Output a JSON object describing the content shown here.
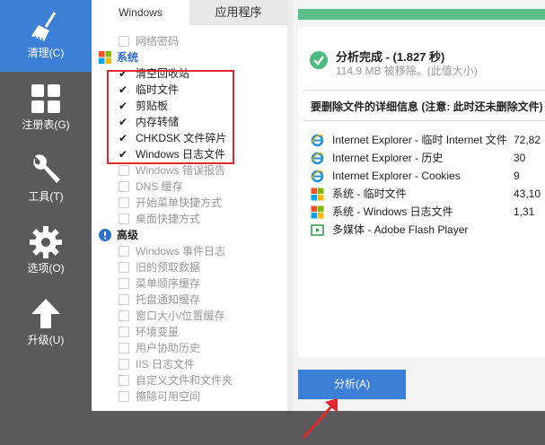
{
  "sidebar": {
    "items": [
      {
        "label": "清理(C)",
        "icon": "broom-icon"
      },
      {
        "label": "注册表(G)",
        "icon": "registry-grid-icon"
      },
      {
        "label": "工具(T)",
        "icon": "wrench-icon"
      },
      {
        "label": "选项(O)",
        "icon": "gear-icon"
      },
      {
        "label": "升级(U)",
        "icon": "up-arrow-icon"
      }
    ]
  },
  "tabs": {
    "windows": "Windows",
    "apps": "应用程序"
  },
  "tree": {
    "top_item": "网络密码",
    "groups": {
      "system": "系统",
      "advanced": "高级"
    },
    "system_items": [
      {
        "label": "清空回收站",
        "checked": true
      },
      {
        "label": "临时文件",
        "checked": true
      },
      {
        "label": "剪贴板",
        "checked": true
      },
      {
        "label": "内存转储",
        "checked": true
      },
      {
        "label": "CHKDSK 文件碎片",
        "checked": true
      },
      {
        "label": "Windows 日志文件",
        "checked": true
      },
      {
        "label": "Windows 错误报告",
        "checked": false
      },
      {
        "label": "DNS 缓存",
        "checked": false
      },
      {
        "label": "开始菜单快捷方式",
        "checked": false
      },
      {
        "label": "桌面快捷方式",
        "checked": false
      }
    ],
    "advanced_items": [
      {
        "label": "Windows 事件日志",
        "checked": false
      },
      {
        "label": "旧的预取数据",
        "checked": false
      },
      {
        "label": "菜单顺序缓存",
        "checked": false
      },
      {
        "label": "托盘通知缓存",
        "checked": false
      },
      {
        "label": "窗口大小/位置缓存",
        "checked": false
      },
      {
        "label": "环境变量",
        "checked": false
      },
      {
        "label": "用户协助历史",
        "checked": false
      },
      {
        "label": "IIS 日志文件",
        "checked": false
      },
      {
        "label": "自定义文件和文件夹",
        "checked": false
      },
      {
        "label": "擦除可用空间",
        "checked": false
      }
    ]
  },
  "result": {
    "progress": 1.0,
    "title": "分析完成 - (1.827 秒)",
    "subtitle": "114.9 MB 被移除。(此值大小)",
    "detail_title": "要删除文件的详细信息 (注意: 此时还未删除文件)",
    "rows": [
      {
        "icon": "internet-explorer-icon",
        "name": "Internet Explorer - 临时 Internet 文件",
        "size": "72,82"
      },
      {
        "icon": "internet-explorer-icon",
        "name": "Internet Explorer - 历史",
        "size": "30"
      },
      {
        "icon": "internet-explorer-icon",
        "name": "Internet Explorer - Cookies",
        "size": "9"
      },
      {
        "icon": "windows-logo-icon",
        "name": "系统 - 临时文件",
        "size": "43,10"
      },
      {
        "icon": "windows-logo-icon",
        "name": "系统 - Windows 日志文件",
        "size": "1,31"
      },
      {
        "icon": "flash-player-icon",
        "name": "多媒体 - Adobe Flash Player",
        "size": ""
      }
    ]
  },
  "analyze_button": "分析(A)",
  "colors": {
    "sidebar_bg": "#5a5a5a",
    "accent_blue": "#3b7fd6",
    "progress_green": "#5cbf8a",
    "highlight_red": "#e0282e"
  }
}
